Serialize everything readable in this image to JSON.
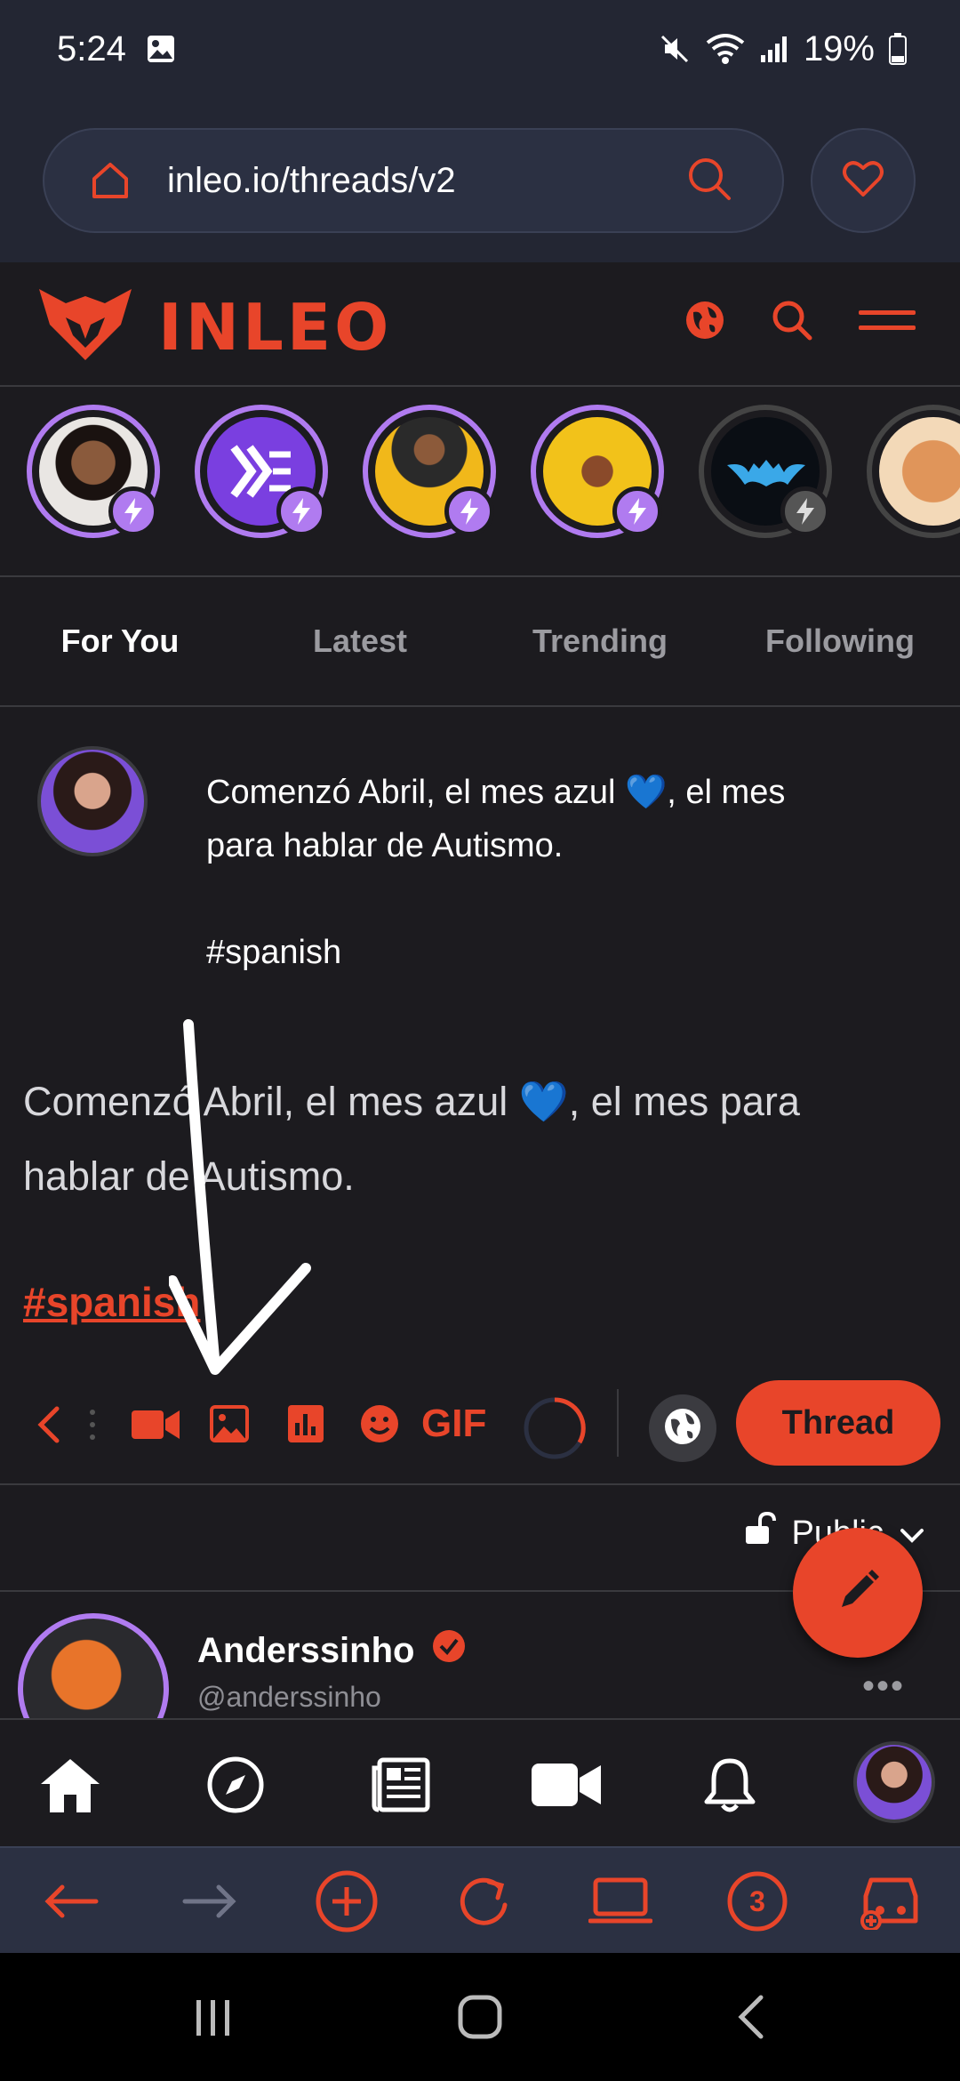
{
  "status_bar": {
    "time": "5:24",
    "battery": "19%"
  },
  "browser": {
    "url": "inleo.io/threads/v2"
  },
  "app": {
    "brand": "INLEO"
  },
  "tabs": [
    {
      "label": "For You",
      "active": true
    },
    {
      "label": "Latest",
      "active": false
    },
    {
      "label": "Trending",
      "active": false
    },
    {
      "label": "Following",
      "active": false
    }
  ],
  "composer": {
    "text_line1": "Comenzó Abril, el mes azul 💙,  el mes",
    "text_line2": "para hablar de Autismo.",
    "text_hashtag": "#spanish",
    "preview_line1": "Comenzó Abril, el mes azul 💙, el mes para",
    "preview_line2": "hablar de Autismo.",
    "preview_hashtag": "#spanish",
    "gif_label": "GIF",
    "submit_label": "Thread",
    "visibility_label": "Public"
  },
  "post": {
    "name": "Anderssinho",
    "handle": "@anderssinho"
  },
  "browser_nav": {
    "tab_count": "3"
  },
  "colors": {
    "accent": "#e8452a",
    "story_ring": "#b07bf0",
    "background": "#1c1b1f",
    "browser_chrome": "#232633"
  }
}
